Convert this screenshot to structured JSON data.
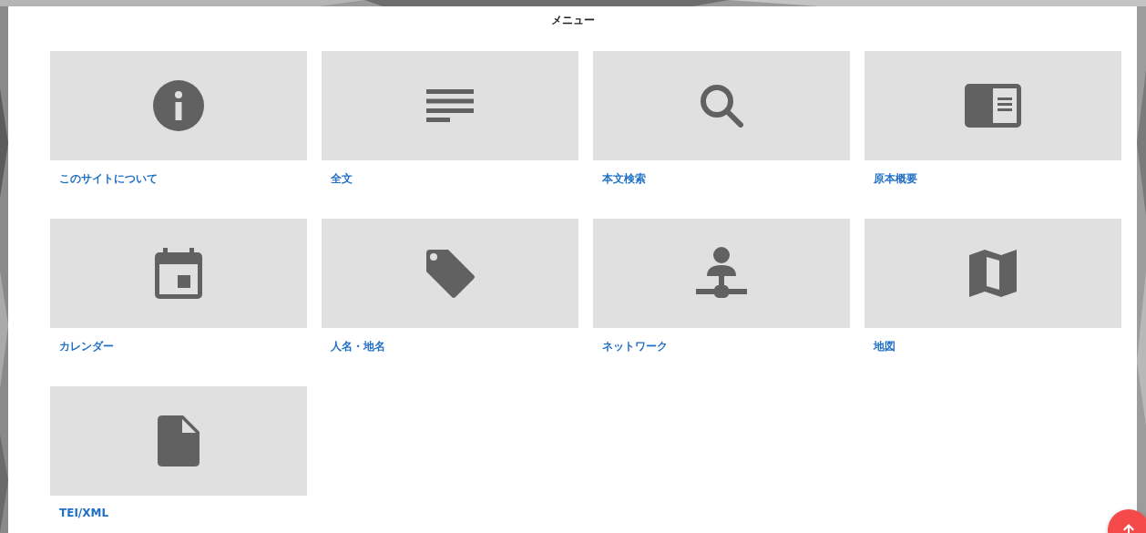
{
  "title": "メニュー",
  "items": [
    {
      "label": "このサイトについて",
      "kind": "info"
    },
    {
      "label": "全文",
      "kind": "text"
    },
    {
      "label": "本文検索",
      "kind": "search"
    },
    {
      "label": "原本概要",
      "kind": "book"
    },
    {
      "label": "カレンダー",
      "kind": "calendar"
    },
    {
      "label": "人名・地名",
      "kind": "tag"
    },
    {
      "label": "ネットワーク",
      "kind": "network"
    },
    {
      "label": "地図",
      "kind": "map"
    },
    {
      "label": "TEI/XML",
      "kind": "file"
    }
  ],
  "scroll_top_button": {
    "kind": "up"
  }
}
